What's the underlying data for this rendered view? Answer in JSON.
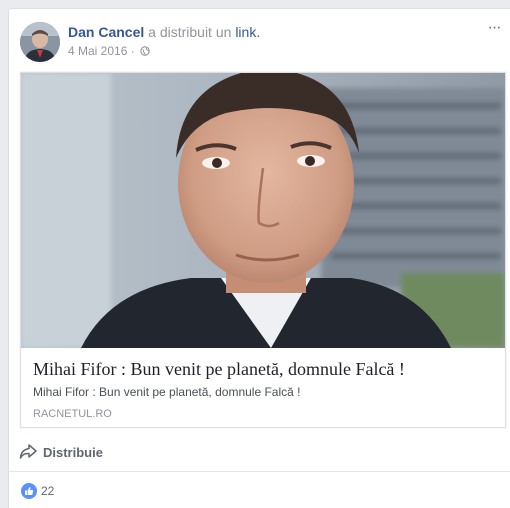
{
  "post": {
    "author": "Dan Cancel",
    "action_text": "a distribuit un",
    "action_link": "link.",
    "date": "4 Mai 2016",
    "separator": "·",
    "more_label": "···"
  },
  "link_card": {
    "title": "Mihai Fifor : Bun venit pe planetă, domnule Falcă !",
    "description": "Mihai Fifor : Bun venit pe planetă, domnule Falcă !",
    "domain": "RACNETUL.RO"
  },
  "actions": {
    "share_label": "Distribuie"
  },
  "reactions": {
    "like_count": "22"
  },
  "colors": {
    "brand_link": "#365899",
    "like_blue": "#5890ff",
    "meta_gray": "#90949c"
  },
  "icons": [
    "globe-icon",
    "more-options-icon",
    "share-icon",
    "like-icon"
  ]
}
